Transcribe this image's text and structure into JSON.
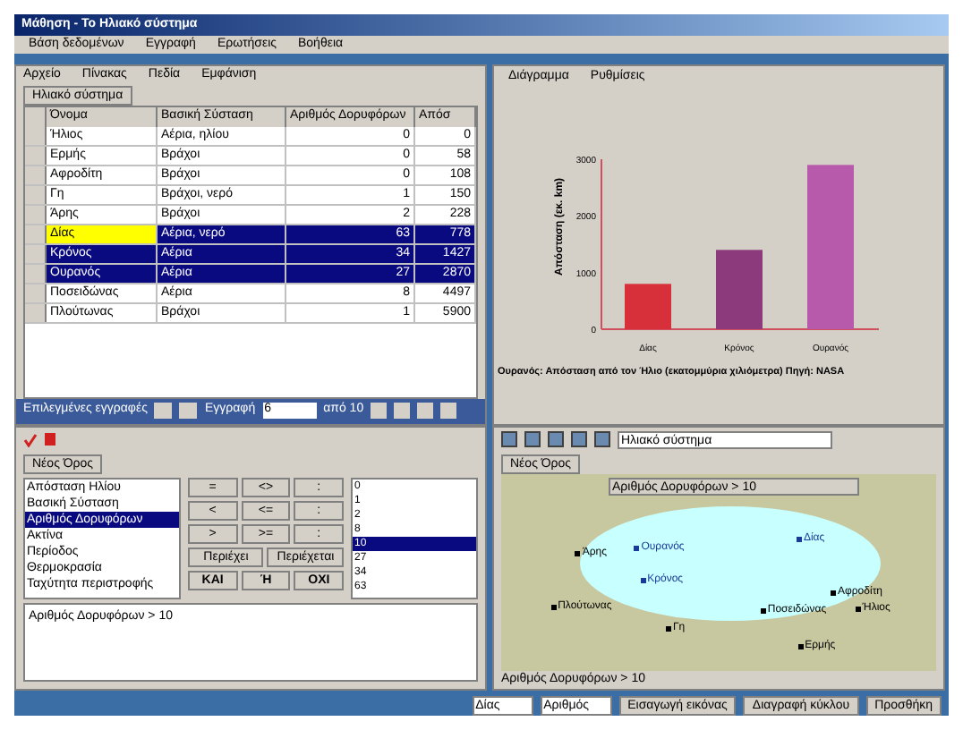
{
  "window": {
    "title": "Μάθηση - Το Ηλιακό σύστημα"
  },
  "menu": [
    "Βάση δεδομένων",
    "Εγγραφή",
    "Ερωτήσεις",
    "Βοήθεια"
  ],
  "table_panel": {
    "menu": [
      "Αρχείο",
      "Πίνακας",
      "Πεδία",
      "Εμφάνιση"
    ],
    "tab": "Ηλιακό σύστημα",
    "columns": [
      "Όνομα",
      "Βασική Σύσταση",
      "Αριθμός Δορυφόρων",
      "Απόσ"
    ],
    "rows": [
      {
        "cells": [
          "Ήλιος",
          "Αέρια, ηλίου",
          "0",
          "0"
        ],
        "selected": false,
        "current": false
      },
      {
        "cells": [
          "Ερμής",
          "Βράχοι",
          "0",
          "58"
        ],
        "selected": false,
        "current": false
      },
      {
        "cells": [
          "Αφροδίτη",
          "Βράχοι",
          "0",
          "108"
        ],
        "selected": false,
        "current": false
      },
      {
        "cells": [
          "Γη",
          "Βράχοι, νερό",
          "1",
          "150"
        ],
        "selected": false,
        "current": false
      },
      {
        "cells": [
          "Άρης",
          "Βράχοι",
          "2",
          "228"
        ],
        "selected": false,
        "current": false
      },
      {
        "cells": [
          "Δίας",
          "Αέρια, νερό",
          "63",
          "778"
        ],
        "selected": true,
        "current": true
      },
      {
        "cells": [
          "Κρόνος",
          "Αέρια",
          "34",
          "1427"
        ],
        "selected": true,
        "current": false
      },
      {
        "cells": [
          "Ουρανός",
          "Αέρια",
          "27",
          "2870"
        ],
        "selected": true,
        "current": false
      },
      {
        "cells": [
          "Ποσειδώνας",
          "Αέρια",
          "8",
          "4497"
        ],
        "selected": false,
        "current": false
      },
      {
        "cells": [
          "Πλούτωνας",
          "Βράχοι",
          "1",
          "5900"
        ],
        "selected": false,
        "current": false
      }
    ],
    "nav": {
      "label": "Επιλεγμένες εγγραφές",
      "record_label": "Εγγραφή",
      "record_value": "6",
      "of": "από 10"
    }
  },
  "chart_panel": {
    "menu": [
      "Διάγραμμα",
      "Ρυθμίσεις"
    ],
    "chart_data": {
      "type": "bar",
      "ylabel": "Απόσταση (εκ. km)",
      "series": [
        {
          "name": "Δίας",
          "color": "#d8303a",
          "values": [
            800,
            null,
            null
          ]
        },
        {
          "name": "Κρόνος",
          "color": "#8c3a7c",
          "values": [
            null,
            1400,
            null
          ]
        },
        {
          "name": "Ουρανός",
          "color": "#b85aac",
          "values": [
            null,
            null,
            2900
          ]
        }
      ],
      "ylim": [
        0,
        3000
      ],
      "yticks": [
        0,
        1000,
        2000,
        3000
      ]
    },
    "caption": "Ουρανός: Απόσταση από τον Ήλιο (εκατομμύρια χιλιόμετρα) Πηγή: NASA"
  },
  "query_panel": {
    "tab": "Νέος Όρος",
    "fields": [
      {
        "label": "Απόσταση Ηλίου",
        "selected": false
      },
      {
        "label": "Βασική Σύσταση",
        "selected": false
      },
      {
        "label": "Αριθμός Δορυφόρων",
        "selected": true
      },
      {
        "label": "Ακτίνα",
        "selected": false
      },
      {
        "label": "Περίοδος",
        "selected": false
      },
      {
        "label": "Θερμοκρασία",
        "selected": false
      },
      {
        "label": "Ταχύτητα περιστροφής",
        "selected": false
      }
    ],
    "keys": [
      "=",
      "<>",
      ":",
      "<",
      "<=",
      ":",
      ">",
      ">=",
      ":"
    ],
    "wide_keys": [
      "Περιέχει",
      "Περιέχεται"
    ],
    "logic_keys": [
      "ΚΑΙ",
      "Ή",
      "ΟΧΙ"
    ],
    "values": [
      {
        "label": "0",
        "selected": false
      },
      {
        "label": "1",
        "selected": false
      },
      {
        "label": "2",
        "selected": false
      },
      {
        "label": "8",
        "selected": false
      },
      {
        "label": "10",
        "selected": true
      },
      {
        "label": "27",
        "selected": false
      },
      {
        "label": "34",
        "selected": false
      },
      {
        "label": "63",
        "selected": false
      }
    ],
    "expression": "Αριθμός Δορυφόρων > 10"
  },
  "venn_panel": {
    "tab": "Νέος Όρος",
    "toolbar_select": "Ηλιακό σύστημα",
    "set_select": "Αριθμός Δορυφόρων > 10",
    "inside": [
      "Ουρανός",
      "Δίας",
      "Κρόνος"
    ],
    "outside": [
      "Άρης",
      "Πλούτωνας",
      "Ποσειδώνας",
      "Γη",
      "Αφροδίτη",
      "Ερμής",
      "Ήλιος"
    ],
    "status": "Αριθμός Δορυφόρων > 10",
    "bottom": {
      "spinner": "Δίας",
      "select": "Αριθμός",
      "buttons": [
        "Εισαγωγή εικόνας",
        "Διαγραφή κύκλου",
        "Προσθήκη"
      ]
    }
  }
}
